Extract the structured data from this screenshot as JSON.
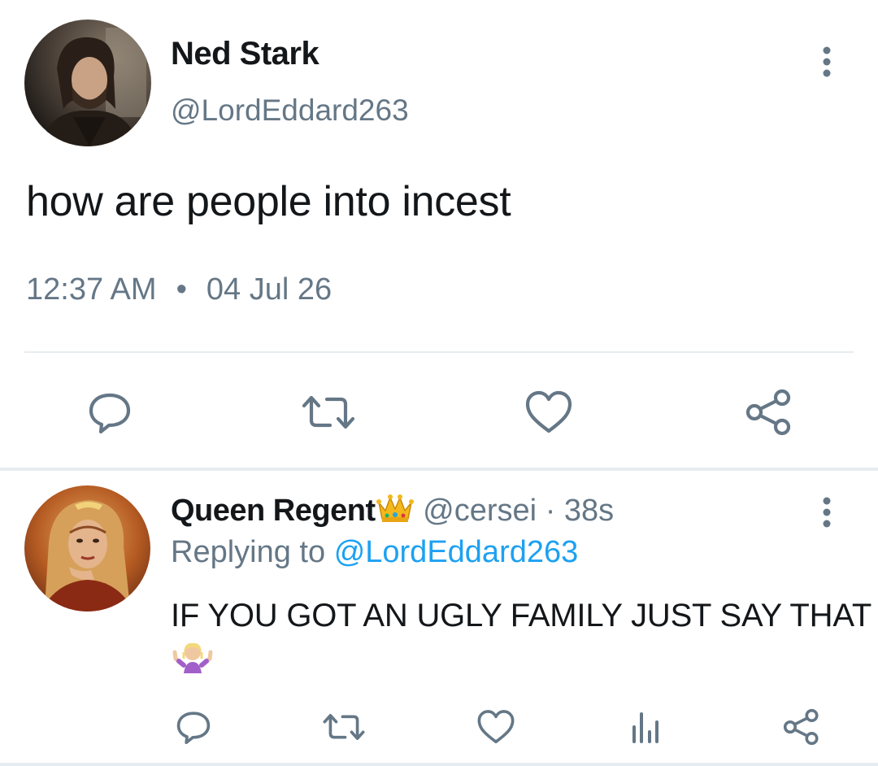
{
  "tweet": {
    "author_name": "Ned Stark",
    "author_handle": "@LordEddard263",
    "text": "how are people into incest",
    "time": "12:37 AM",
    "separator": "•",
    "date": "04 Jul 26",
    "actions": {
      "reply_icon": "reply-icon",
      "retweet_icon": "retweet-icon",
      "like_icon": "heart-icon",
      "share_icon": "share-icon"
    },
    "more_icon": "more-vertical-icon"
  },
  "reply": {
    "author_name": "Queen Regent",
    "author_emoji": "crown",
    "author_handle": "@cersei",
    "dot": "·",
    "age": "38s",
    "replying_label": "Replying to",
    "replying_mention": "@LordEddard263",
    "text": "IF YOU GOT AN UGLY FAMILY JUST SAY THAT",
    "emoji": "person-shrugging",
    "actions": {
      "reply_icon": "reply-icon",
      "retweet_icon": "retweet-icon",
      "like_icon": "heart-icon",
      "stats_icon": "stats-icon",
      "share_icon": "share-icon"
    },
    "more_icon": "more-vertical-icon"
  },
  "colors": {
    "primary_text": "#14171a",
    "secondary_text": "#657786",
    "link": "#1da1f2",
    "divider": "#e6ecf0"
  }
}
